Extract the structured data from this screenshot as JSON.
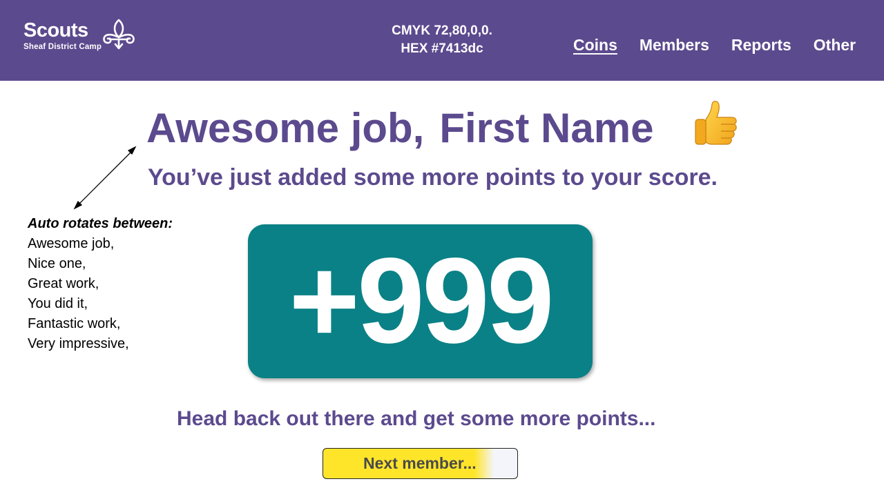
{
  "header": {
    "logo_word": "Scouts",
    "logo_sub": "Sheaf District Camp",
    "color_cmyk": "CMYK 72,80,0,0.",
    "color_hex": "HEX #7413dc",
    "nav": [
      {
        "label": "Coins",
        "active": true
      },
      {
        "label": "Members",
        "active": false
      },
      {
        "label": "Reports",
        "active": false
      },
      {
        "label": "Other",
        "active": false
      }
    ]
  },
  "main": {
    "greeting": "Awesome job,",
    "name": "First Name",
    "subline": "You’ve just added some more points to your score.",
    "score": "+999",
    "encouragement": "Head back out there and get some more points...",
    "next_button": "Next member..."
  },
  "annotation": {
    "title": "Auto rotates between:",
    "options": [
      "Awesome job,",
      "Nice one,",
      "Great work,",
      "You did it,",
      "Fantastic work,",
      "Very impressive,"
    ]
  },
  "icons": {
    "logo": "fleur-de-lis-icon",
    "thumb": "thumbs-up-icon",
    "arrow": "double-arrow-icon"
  },
  "colors": {
    "brand_purple": "#5c4a8e",
    "score_teal": "#0a8186",
    "button_yellow": "#ffe52a"
  }
}
